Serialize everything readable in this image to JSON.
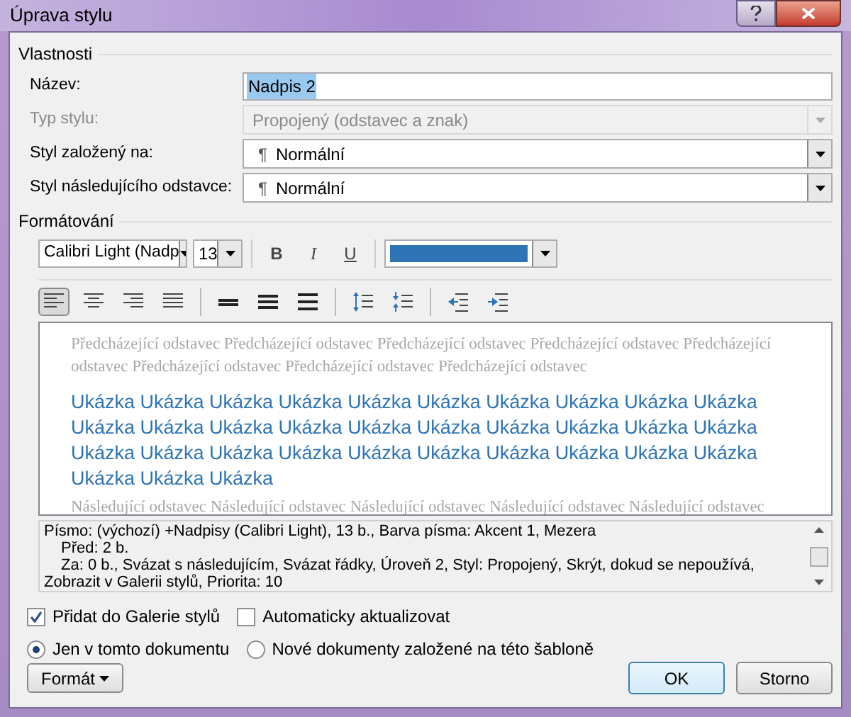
{
  "window": {
    "title": "Úprava stylu"
  },
  "properties": {
    "heading": "Vlastnosti",
    "fields": [
      {
        "label": "Název:",
        "kind": "text",
        "value": "Nadpis 2",
        "disabled": false
      },
      {
        "label": "Typ stylu:",
        "kind": "dropdown",
        "value": "Propojený (odstavec a znak)",
        "disabled": true
      },
      {
        "label": "Styl založený na:",
        "kind": "dropdown",
        "pilcrow": "¶",
        "value": "Normální",
        "disabled": false
      },
      {
        "label": "Styl následujícího odstavce:",
        "kind": "dropdown",
        "pilcrow": "¶",
        "value": "Normální",
        "disabled": false
      }
    ]
  },
  "formatting": {
    "heading": "Formátování",
    "font": "Calibri Light (Nadp",
    "size": "13",
    "style_buttons": [
      {
        "label": "B",
        "kind": "bold",
        "selected": false
      },
      {
        "label": "I",
        "kind": "italic",
        "selected": false
      },
      {
        "label": "U",
        "kind": "underline",
        "selected": false
      }
    ],
    "paragraph_buttons": [
      {
        "kind": "align-left",
        "selected": true
      },
      {
        "kind": "align-center",
        "selected": false
      },
      {
        "kind": "align-right",
        "selected": false
      },
      {
        "kind": "justify",
        "selected": false
      },
      {
        "kind": "spacing-single",
        "selected": false
      },
      {
        "kind": "spacing-one-half",
        "selected": false
      },
      {
        "kind": "spacing-double",
        "selected": false
      },
      {
        "kind": "space-increase",
        "selected": false
      },
      {
        "kind": "space-decrease",
        "selected": false
      },
      {
        "kind": "indent-decrease",
        "selected": false
      },
      {
        "kind": "indent-increase",
        "selected": false
      }
    ]
  },
  "preview": {
    "previous": "Předcházející odstavec Předcházející odstavec Předcházející odstavec Předcházející odstavec Předcházející odstavec Předcházející odstavec Předcházející odstavec Předcházející odstavec",
    "sample": "Ukázka Ukázka Ukázka Ukázka Ukázka Ukázka Ukázka Ukázka Ukázka Ukázka Ukázka Ukázka Ukázka Ukázka Ukázka Ukázka Ukázka Ukázka Ukázka Ukázka Ukázka Ukázka Ukázka Ukázka Ukázka Ukázka Ukázka Ukázka Ukázka Ukázka Ukázka Ukázka Ukázka",
    "next": "Následující odstavec Následující odstavec Následující odstavec Následující odstavec Následující odstavec"
  },
  "description": [
    {
      "kind": "plain",
      "text": "Písmo: (výchozí) +Nadpisy (Calibri Light), 13 b., Barva písma: Akcent 1, Mezera"
    },
    {
      "kind": "indented",
      "text": "Před:  2 b."
    },
    {
      "kind": "indented",
      "text": "Za:  0 b., Svázat s následujícím, Svázat řádky, Úroveň 2, Styl: Propojený, Skrýt, dokud se nepoužívá, Zobrazit v Galerii stylů, Priorita: 10"
    }
  ],
  "checkboxes": [
    {
      "label": "Přidat do Galerie stylů",
      "checked": true
    },
    {
      "label": "Automaticky aktualizovat",
      "checked": false
    }
  ],
  "radios": [
    {
      "label": "Jen v tomto dokumentu",
      "selected": true
    },
    {
      "label": "Nové dokumenty založené na této šabloně",
      "selected": false
    }
  ],
  "buttons": {
    "format": "Formát",
    "ok": "OK",
    "cancel": "Storno"
  }
}
